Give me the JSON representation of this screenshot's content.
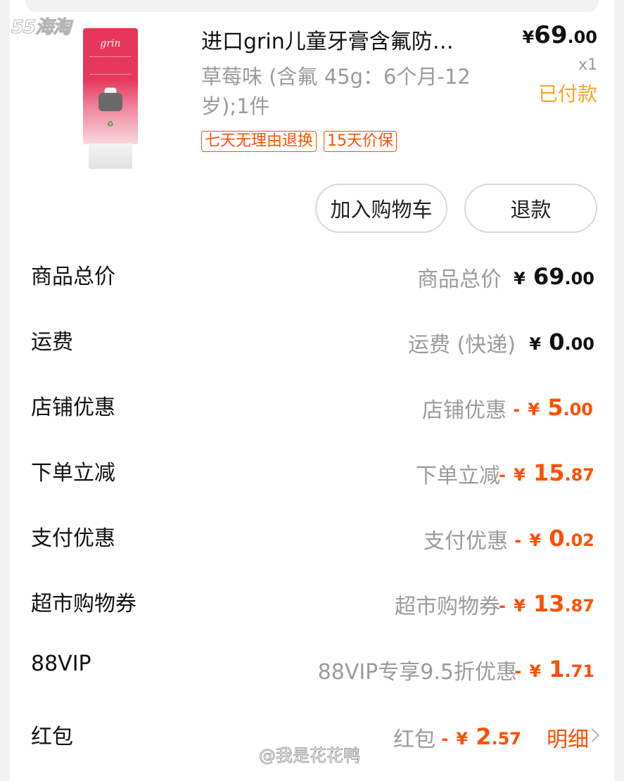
{
  "watermark": {
    "site_logo": "55海淘",
    "user": "@我是花花鸭"
  },
  "product": {
    "title": "进口grin儿童牙膏含氟防…",
    "sku": "草莓味 (含氟 45g：6个月-12岁);1件",
    "price_currency": "¥",
    "price_int": "69",
    "price_dec": ".00",
    "quantity": "x1",
    "status": "已付款",
    "tags": [
      "七天无理由退换",
      "15天价保"
    ],
    "image_brand": "grin"
  },
  "actions": {
    "add_to_cart": "加入购物车",
    "refund": "退款"
  },
  "breakdown": [
    {
      "label": "商品总价",
      "desc": "商品总价",
      "sign": "",
      "currency": "¥",
      "int": "69",
      "dec": ".00",
      "color": "black"
    },
    {
      "label": "运费",
      "desc": "运费 (快递)",
      "sign": "",
      "currency": "¥",
      "int": "0",
      "dec": ".00",
      "color": "black"
    },
    {
      "label": "店铺优惠",
      "desc": "店铺优惠",
      "sign": "-",
      "currency": "¥",
      "int": "5",
      "dec": ".00",
      "color": "orange"
    },
    {
      "label": "下单立减",
      "desc": "下单立减",
      "sign": "-",
      "currency": "¥",
      "int": "15",
      "dec": ".87",
      "color": "orange"
    },
    {
      "label": "支付优惠",
      "desc": "支付优惠",
      "sign": "-",
      "currency": "¥",
      "int": "0",
      "dec": ".02",
      "color": "orange"
    },
    {
      "label": "超市购物券",
      "desc": "超市购物券",
      "sign": "-",
      "currency": "¥",
      "int": "13",
      "dec": ".87",
      "color": "orange"
    },
    {
      "label": "88VIP",
      "desc": "88VIP专享9.5折优惠",
      "sign": "-",
      "currency": "¥",
      "int": "1",
      "dec": ".71",
      "color": "orange"
    },
    {
      "label": "红包",
      "desc": "红包",
      "sign": "-",
      "currency": "¥",
      "int": "2",
      "dec": ".57",
      "color": "orange",
      "link": "明细"
    }
  ],
  "colors": {
    "accent_orange": "#ff5000",
    "paid_status": "#f5a623",
    "muted_text": "#9b9b9b"
  }
}
